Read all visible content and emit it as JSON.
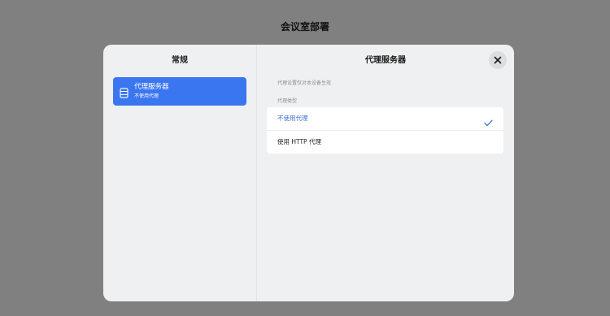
{
  "page": {
    "title": "会议室部署"
  },
  "sidebar": {
    "title": "常规",
    "items": [
      {
        "label": "代理服务器",
        "sublabel": "不使用代理",
        "icon": "server-icon",
        "selected": true
      }
    ]
  },
  "panel": {
    "title": "代理服务器",
    "note": "代理设置仅对本设备生效",
    "section_label": "代理类型",
    "options": [
      {
        "label": "不使用代理",
        "selected": true
      },
      {
        "label": "使用 HTTP 代理",
        "selected": false
      }
    ],
    "close_icon": "close-icon",
    "check_icon": "checkmark-icon"
  },
  "colors": {
    "backdrop": "#808080",
    "accent": "#3b76f1",
    "selected_text": "#3b6fd8",
    "modal_bg": "#eff0f1"
  }
}
